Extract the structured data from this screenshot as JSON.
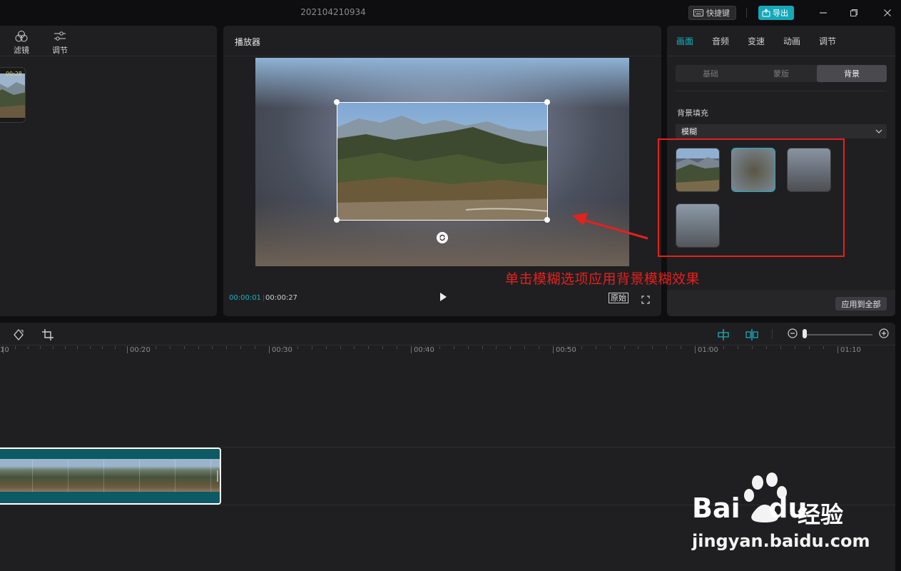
{
  "window": {
    "doc_title": "202104210934",
    "shortcut_label": "快捷键",
    "export_label": "导出"
  },
  "media_panel": {
    "tools": [
      {
        "label": "滤镜",
        "icon": "filter-icon"
      },
      {
        "label": "调节",
        "icon": "adjust-icon"
      }
    ],
    "thumb_duration": "00:28"
  },
  "player": {
    "title": "播放器",
    "time_current": "00:00:01",
    "time_separator": "|",
    "time_total": "00:00:27",
    "original_label": "原始"
  },
  "properties": {
    "tabs": [
      "画面",
      "音频",
      "变速",
      "动画",
      "调节"
    ],
    "active_tab": "画面",
    "segments": [
      "基础",
      "蒙版",
      "背景"
    ],
    "active_segment": "背景",
    "bg_fill_label": "背景填充",
    "fill_mode": "模糊",
    "blur_options": [
      "blur-level-1",
      "blur-level-2",
      "blur-level-3",
      "blur-level-4"
    ],
    "selected_blur": 2,
    "apply_all_label": "应用到全部"
  },
  "annotation": {
    "text": "单击模糊选项应用背景模糊效果",
    "color": "#e4211d"
  },
  "timeline": {
    "ruler_labels": [
      "10",
      "00:20",
      "00:30",
      "00:40",
      "00:50",
      "01:00",
      "01:10"
    ]
  },
  "watermark": {
    "brand": "Bai du 经验",
    "url": "jingyan.baidu.com"
  },
  "colors": {
    "accent": "#19b3c4",
    "export": "#17a8b8",
    "clip": "#0c5a64"
  }
}
